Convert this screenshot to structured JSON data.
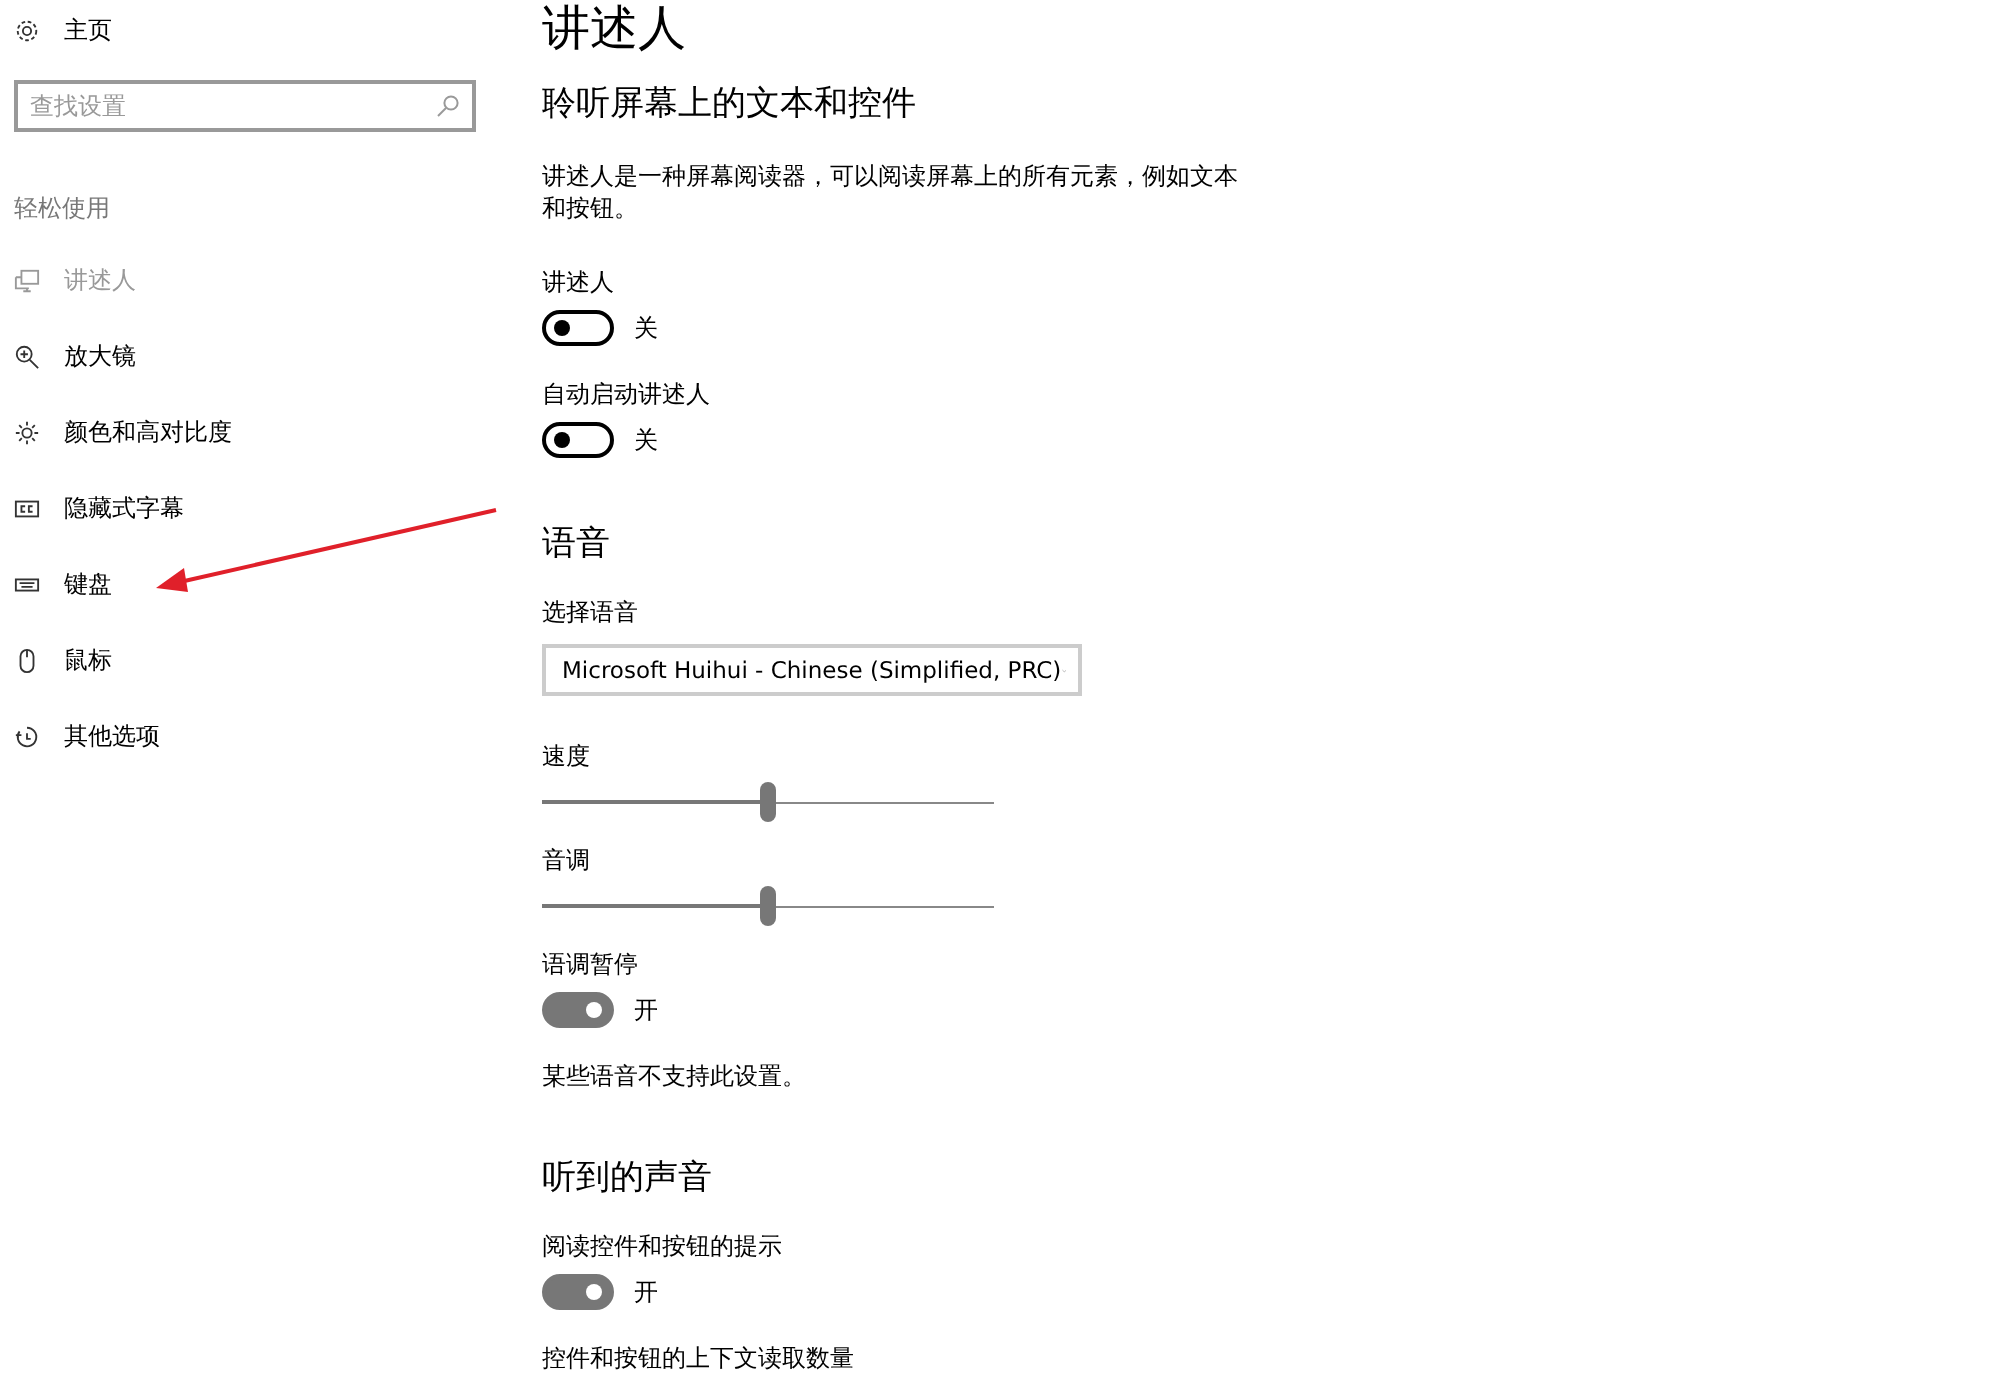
{
  "sidebar": {
    "home": "主页",
    "search": {
      "placeholder": "查找设置"
    },
    "group_label": "轻松使用",
    "items": [
      {
        "label": "讲述人",
        "selected": true
      },
      {
        "label": "放大镜",
        "selected": false
      },
      {
        "label": "颜色和高对比度",
        "selected": false
      },
      {
        "label": "隐藏式字幕",
        "selected": false
      },
      {
        "label": "键盘",
        "selected": false
      },
      {
        "label": "鼠标",
        "selected": false
      },
      {
        "label": "其他选项",
        "selected": false
      }
    ]
  },
  "content": [
    {
      "kind": "title",
      "text": "讲述人"
    },
    {
      "kind": "subheading",
      "text": "聆听屏幕上的文本和控件"
    },
    {
      "kind": "paragraph",
      "text": "讲述人是一种屏幕阅读器，可以阅读屏幕上的所有元素，例如文本和按钮。"
    },
    {
      "kind": "label",
      "text": "讲述人"
    },
    {
      "kind": "toggle",
      "on": false,
      "state_text": "关"
    },
    {
      "kind": "label",
      "text": "自动启动讲述人"
    },
    {
      "kind": "toggle",
      "on": false,
      "state_text": "关"
    },
    {
      "kind": "heading",
      "text": "语音"
    },
    {
      "kind": "label",
      "text": "选择语音"
    },
    {
      "kind": "dropdown",
      "value": "Microsoft Huihui - Chinese (Simplified, PRC)"
    },
    {
      "kind": "label",
      "text": "速度"
    },
    {
      "kind": "slider",
      "level": 0.5
    },
    {
      "kind": "label",
      "text": "音调"
    },
    {
      "kind": "slider",
      "level": 0.5
    },
    {
      "kind": "label",
      "text": "语调暂停"
    },
    {
      "kind": "toggle",
      "on": true,
      "state_text": "开"
    },
    {
      "kind": "note",
      "text": "某些语音不支持此设置。"
    },
    {
      "kind": "heading",
      "text": "听到的声音"
    },
    {
      "kind": "label",
      "text": "阅读控件和按钮的提示"
    },
    {
      "kind": "toggle",
      "on": true,
      "state_text": "开"
    },
    {
      "kind": "label",
      "text": "控件和按钮的上下文读取数量"
    }
  ]
}
